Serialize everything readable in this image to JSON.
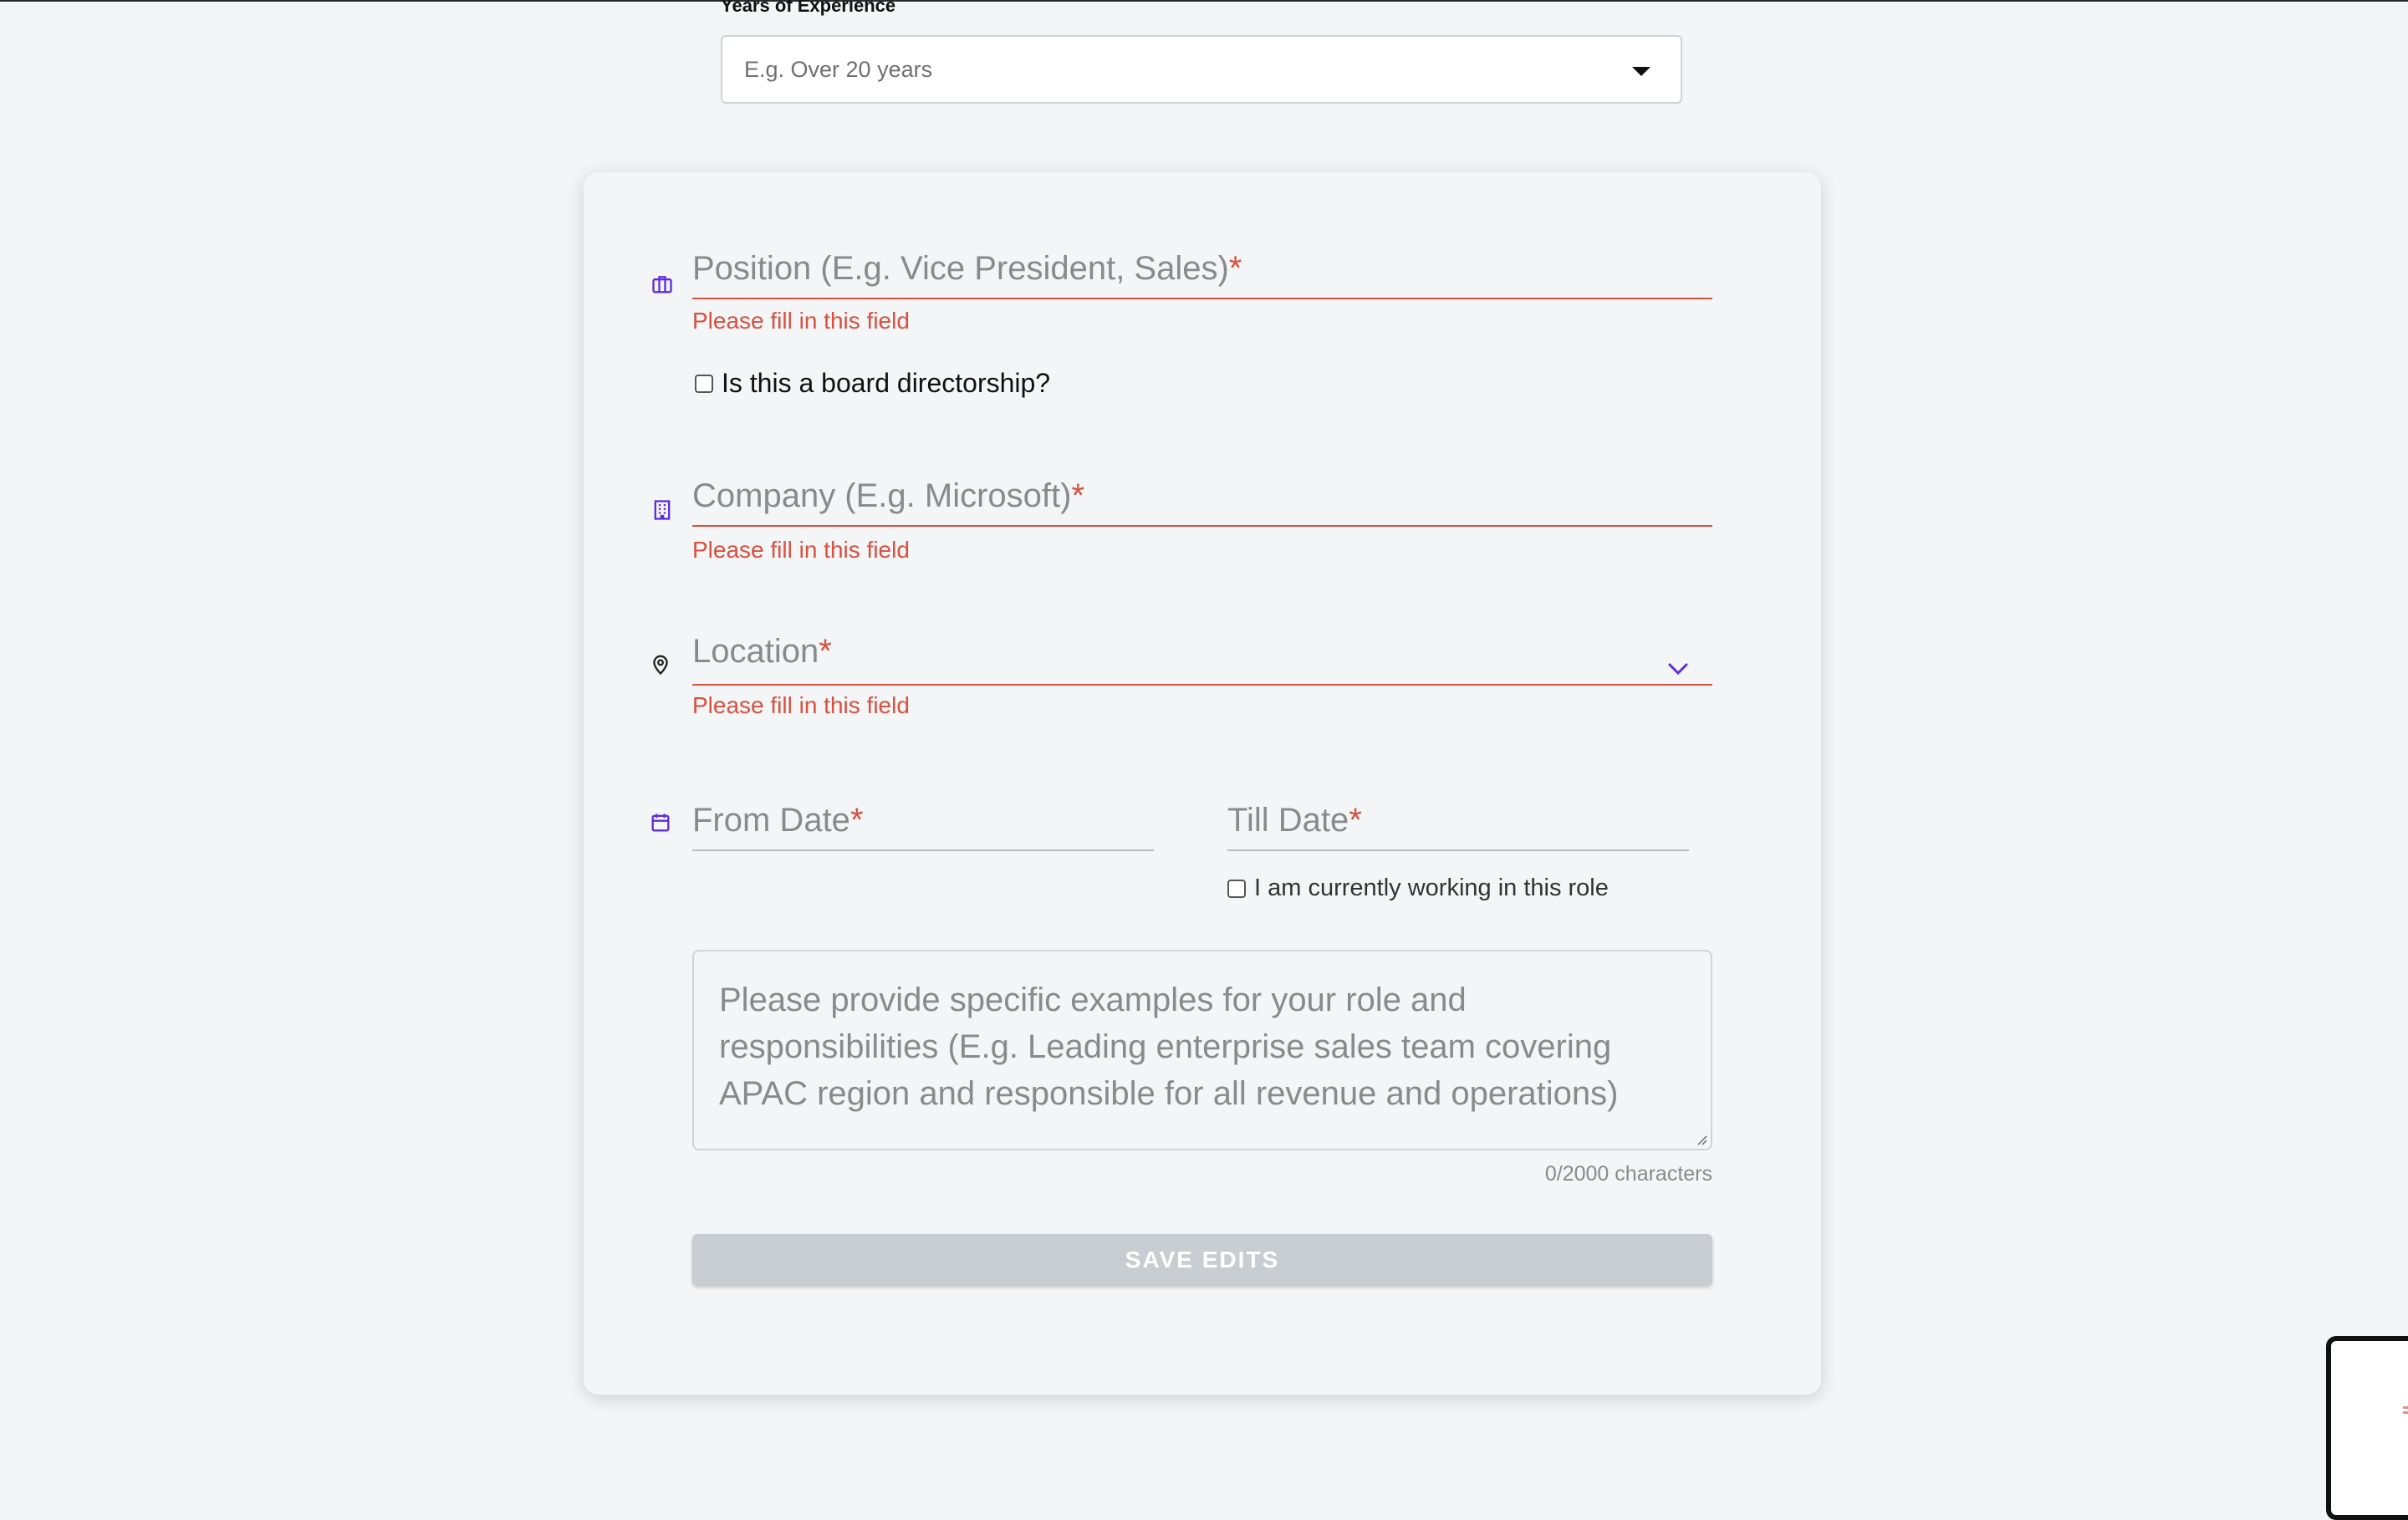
{
  "years_of_experience": {
    "label": "Years of Experience",
    "placeholder": "E.g. Over 20 years"
  },
  "form": {
    "position": {
      "label": "Position (E.g. Vice President, Sales)",
      "required_mark": "*",
      "error": "Please fill in this field",
      "icon": "briefcase-icon"
    },
    "board_directorship": {
      "label": "Is this a board directorship?",
      "checked": false
    },
    "company": {
      "label": "Company (E.g. Microsoft)",
      "required_mark": "*",
      "error": "Please fill in this field",
      "icon": "building-icon"
    },
    "location": {
      "label": "Location",
      "required_mark": "*",
      "error": "Please fill in this field",
      "icon": "location-pin-icon"
    },
    "from_date": {
      "label": "From Date",
      "required_mark": "*",
      "icon": "calendar-icon"
    },
    "till_date": {
      "label": "Till Date",
      "required_mark": "*"
    },
    "currently_working": {
      "label": "I am currently working in this role",
      "checked": false
    },
    "description": {
      "placeholder": "Please provide specific examples for your role and responsibilities (E.g. Leading enterprise sales team covering APAC region and responsible for all revenue and operations)",
      "char_count": "0/2000 characters"
    },
    "save_button": {
      "label": "SAVE EDITS"
    }
  },
  "colors": {
    "accent": "#5b2de0",
    "error": "#d9503f",
    "button_disabled": "#c7cdd0",
    "background": "#f4f5f7"
  }
}
